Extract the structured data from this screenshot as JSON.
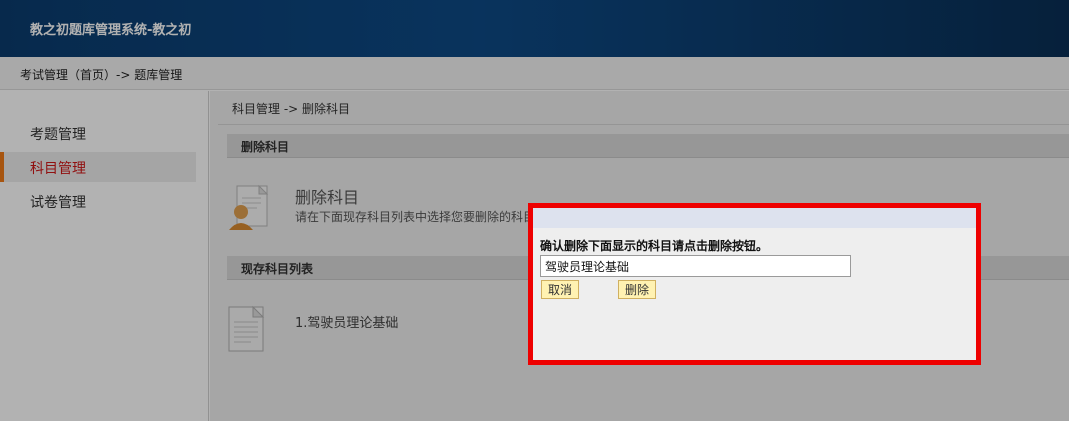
{
  "app": {
    "title": "教之初题库管理系统-教之初"
  },
  "breadcrumb": {
    "text": "考试管理（首页）-> 题库管理"
  },
  "sidebar": {
    "items": [
      {
        "label": "考题管理",
        "active": false
      },
      {
        "label": "科目管理",
        "active": true
      },
      {
        "label": "试卷管理",
        "active": false
      }
    ]
  },
  "main": {
    "breadcrumb": "科目管理  -> 删除科目",
    "delete_section": {
      "header": "删除科目",
      "title": "删除科目",
      "description": "请在下面现存科目列表中选择您要删除的科目"
    },
    "list_section": {
      "header": "现存科目列表",
      "items": [
        "1.驾驶员理论基础"
      ]
    }
  },
  "dialog": {
    "message": "确认删除下面显示的科目请点击删除按钮。",
    "input_value": "驾驶员理论基础",
    "cancel_label": "取消",
    "delete_label": "删除"
  },
  "colors": {
    "header_bg": "#0d4a86",
    "active_accent": "#f07a18",
    "active_text": "#d01818",
    "dialog_border": "#ee0000",
    "button_bg": "#fff2b2"
  },
  "icons": [
    "user-document-icon",
    "document-icon"
  ]
}
